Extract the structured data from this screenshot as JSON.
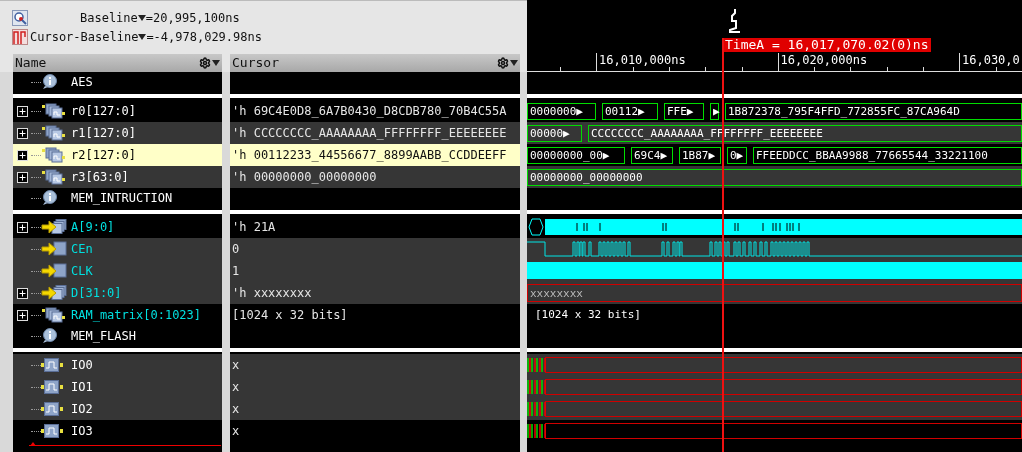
{
  "header": {
    "baseline": {
      "label": "Baseline",
      "value": "=20,995,100ns"
    },
    "delta": {
      "label": "Cursor-Baseline",
      "value": "=-4,978,029.98ns"
    }
  },
  "columns": [
    "Name",
    "Cursor"
  ],
  "timeline": {
    "ticks": [
      "16,010,000ns",
      "16,020,000ns",
      "16,030,0"
    ],
    "cursor_label": "TimeA = 16,017,070.02(0)ns"
  },
  "rows": [
    {
      "kind": "group",
      "name": "AES",
      "color": "#ffffff",
      "shaded": false,
      "selected": false,
      "wave": {
        "kind": "blank"
      }
    },
    {
      "kind": "separator"
    },
    {
      "kind": "bus",
      "name": "r0[127:0]",
      "value": "'h 69C4E0D8_6A7B0430_D8CDB780_70B4C55A",
      "expanded": false,
      "color": "#ffffff",
      "shaded": false,
      "selected": false,
      "wave": {
        "kind": "bus",
        "segments": [
          "0000000▶",
          "00112▶",
          "FFE▶",
          "▶",
          "1B872378_795F4FFD_772855FC_87CA964D"
        ]
      }
    },
    {
      "kind": "bus",
      "name": "r1[127:0]",
      "value": "'h CCCCCCCC_AAAAAAAA_FFFFFFFF_EEEEEEEE",
      "expanded": false,
      "color": "#ffffff",
      "shaded": true,
      "selected": false,
      "wave": {
        "kind": "bus",
        "segments": [
          "00000▶",
          "CCCCCCCC_AAAAAAAA_FFFFFFFF_EEEEEEEE"
        ]
      }
    },
    {
      "kind": "bus",
      "name": "r2[127:0]",
      "value": "'h 00112233_44556677_8899AABB_CCDDEEFF",
      "expanded": false,
      "color": "#000000",
      "shaded": false,
      "selected": true,
      "wave": {
        "kind": "bus",
        "segments": [
          "00000000_00▶",
          "69C4▶",
          "1B87▶",
          "0▶",
          "FFEEDDCC_BBAA9988_77665544_33221100"
        ]
      }
    },
    {
      "kind": "bus",
      "name": "r3[63:0]",
      "value": "'h 00000000_00000000",
      "expanded": false,
      "color": "#ffffff",
      "shaded": true,
      "selected": false,
      "wave": {
        "kind": "bus",
        "segments": [
          "00000000_00000000"
        ]
      }
    },
    {
      "kind": "group",
      "name": "MEM_INTRUCTION",
      "color": "#ffffff",
      "shaded": false,
      "selected": false,
      "wave": {
        "kind": "blank"
      }
    },
    {
      "kind": "separator"
    },
    {
      "kind": "input_bus",
      "name": "A[9:0]",
      "value": "'h 21A",
      "expanded": false,
      "color": "#00e0e0",
      "shaded": false,
      "selected": false,
      "wave": {
        "kind": "dense"
      }
    },
    {
      "kind": "input",
      "name": "CEn",
      "value": "0",
      "color": "#00e0e0",
      "shaded": true,
      "selected": false,
      "wave": {
        "kind": "pulses"
      }
    },
    {
      "kind": "input",
      "name": "CLK",
      "value": "1",
      "color": "#00e0e0",
      "shaded": true,
      "selected": false,
      "wave": {
        "kind": "high"
      }
    },
    {
      "kind": "input_bus",
      "name": "D[31:0]",
      "value": "'h xxxxxxxx",
      "expanded": false,
      "color": "#00e0e0",
      "shaded": true,
      "selected": false,
      "wave": {
        "kind": "unknown",
        "text": "xxxxxxxx"
      }
    },
    {
      "kind": "bus",
      "name": "RAM_matrix[0:1023]",
      "value": "[1024 x 32 bits]",
      "expanded": false,
      "color": "#00e0e0",
      "shaded": false,
      "selected": false,
      "wave": {
        "kind": "memory",
        "text": "[1024 x 32 bits]"
      }
    },
    {
      "kind": "group",
      "name": "MEM_FLASH",
      "color": "#ffffff",
      "shaded": false,
      "selected": false,
      "wave": {
        "kind": "blank"
      }
    },
    {
      "kind": "separator"
    },
    {
      "kind": "signal",
      "name": "IO0",
      "value": "x",
      "color": "#ffffff",
      "shaded": true,
      "selected": false,
      "wave": {
        "kind": "glitch"
      }
    },
    {
      "kind": "signal",
      "name": "IO1",
      "value": "x",
      "color": "#ffffff",
      "shaded": true,
      "selected": false,
      "wave": {
        "kind": "glitch"
      }
    },
    {
      "kind": "signal",
      "name": "IO2",
      "value": "x",
      "color": "#ffffff",
      "shaded": true,
      "selected": false,
      "wave": {
        "kind": "glitch"
      }
    },
    {
      "kind": "signal",
      "name": "IO3",
      "value": "x",
      "color": "#ffffff",
      "shaded": false,
      "selected": false,
      "wave": {
        "kind": "glitch"
      }
    }
  ]
}
